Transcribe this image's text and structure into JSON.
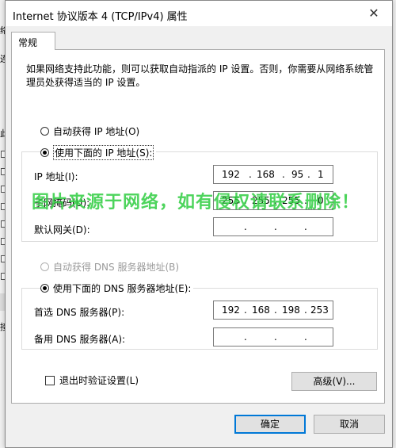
{
  "dialog": {
    "title": "Internet 协议版本 4 (TCP/IPv4) 属性",
    "tab_general": "常规",
    "description": "如果网络支持此功能，则可以获取自动指派的 IP 设置。否则，你需要从网络系统管理员处获得适当的 IP 设置。",
    "auto_ip_label": "自动获得 IP 地址(O)",
    "manual_ip_label": "使用下面的 IP 地址(S):",
    "ip_address_label": "IP 地址(I):",
    "ip_address": [
      "192",
      "168",
      "95",
      "1"
    ],
    "subnet_label": "子网掩码(U):",
    "subnet": [
      "255",
      "255",
      "255",
      "0"
    ],
    "gateway_label": "默认网关(D):",
    "gateway": [
      "",
      "",
      "",
      ""
    ],
    "auto_dns_label": "自动获得 DNS 服务器地址(B)",
    "manual_dns_label": "使用下面的 DNS 服务器地址(E):",
    "preferred_dns_label": "首选 DNS 服务器(P):",
    "preferred_dns": [
      "192",
      "168",
      "198",
      "253"
    ],
    "alternate_dns_label": "备用 DNS 服务器(A):",
    "alternate_dns": [
      "",
      "",
      "",
      ""
    ],
    "validate_label": "退出时验证设置(L)",
    "advanced_button": "高级(V)...",
    "ok_button": "确定",
    "cancel_button": "取消",
    "close_glyph": "✕",
    "dot": "."
  },
  "background": {
    "frag1": "络",
    "frag2": "连",
    "frag3": "此",
    "frag4": "接"
  },
  "watermark": "图片来源于网络，如有侵权请联系删除！",
  "colors": {
    "accent": "#0078d7",
    "watermark": "#2ecc40"
  }
}
